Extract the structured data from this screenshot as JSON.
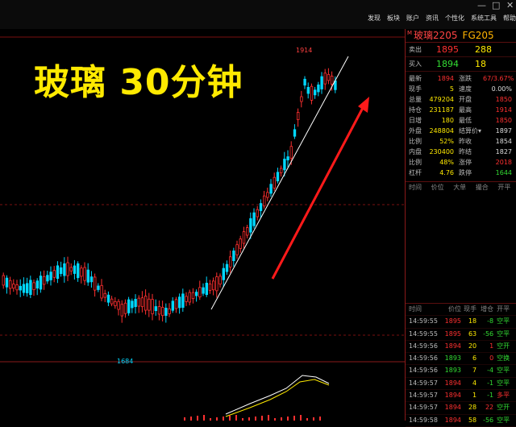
{
  "window": {
    "controls": [
      "—",
      "□",
      "✕"
    ]
  },
  "menu": [
    "发现",
    "板块",
    "账户",
    "资讯",
    "个性化",
    "系统工具",
    "帮助"
  ],
  "overlay_title": "玻璃 30分钟",
  "chart": {
    "high_label": "1914",
    "low_label": "1684",
    "up_color": "#ff3030",
    "down_color": "#00d8ff"
  },
  "panel": {
    "header_mark": "M",
    "name": "玻璃2205",
    "code": "FG205",
    "ask": {
      "label": "卖出",
      "price": "1895",
      "vol": "288"
    },
    "bid": {
      "label": "买入",
      "price": "1894",
      "vol": "18"
    },
    "stats": [
      [
        "最新",
        "1894",
        "涨跌",
        "67/3.67%"
      ],
      [
        "现手",
        "5",
        "速度",
        "0.00%"
      ],
      [
        "总量",
        "479204",
        "开盘",
        "1850"
      ],
      [
        "持仓",
        "231187",
        "最高",
        "1914"
      ],
      [
        "日增",
        "180",
        "最低",
        "1850"
      ],
      [
        "外盘",
        "248804",
        "结算价▾",
        "1897"
      ],
      [
        "比例",
        "52%",
        "昨收",
        "1854"
      ],
      [
        "内盘",
        "230400",
        "昨结",
        "1827"
      ],
      [
        "比例",
        "48%",
        "涨停",
        "2018"
      ],
      [
        "杠杆",
        "4.76",
        "跌停",
        "1644"
      ]
    ],
    "list_header": [
      "时间",
      "价位",
      "大单",
      "撮合",
      "开平"
    ],
    "tick_header": [
      "时间",
      "价位",
      "现手",
      "增仓",
      "开平"
    ],
    "ticks": [
      [
        "14:59:55",
        "1895",
        "18",
        "-8",
        "空平"
      ],
      [
        "14:59:55",
        "1895",
        "63",
        "-56",
        "空平"
      ],
      [
        "14:59:56",
        "1894",
        "20",
        "1",
        "空开"
      ],
      [
        "14:59:56",
        "1893",
        "6",
        "0",
        "空换"
      ],
      [
        "14:59:56",
        "1893",
        "7",
        "-4",
        "空平"
      ],
      [
        "14:59:57",
        "1894",
        "4",
        "-1",
        "空平"
      ],
      [
        "14:59:57",
        "1894",
        "1",
        "-1",
        "多平"
      ],
      [
        "14:59:57",
        "1894",
        "28",
        "22",
        "空开"
      ],
      [
        "14:59:58",
        "1894",
        "58",
        "-56",
        "空平"
      ]
    ]
  }
}
